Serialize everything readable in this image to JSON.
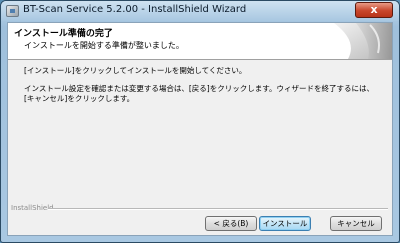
{
  "window": {
    "title": "BT-Scan Service 5.2.00 - InstallShield Wizard",
    "close_label": "x"
  },
  "header": {
    "title": "インストール準備の完了",
    "subtitle": "インストールを開始する準備が整いました。"
  },
  "body": {
    "line1": "[インストール]をクリックしてインストールを開始してください。",
    "line2": "インストール設定を確認または変更する場合は、[戻る]をクリックします。ウィザードを終了するには、[キャンセル]をクリックします。"
  },
  "footer": {
    "brand": "InstallShield"
  },
  "buttons": {
    "back": "< 戻る(B)",
    "install": "インストール",
    "cancel": "キャンセル"
  }
}
